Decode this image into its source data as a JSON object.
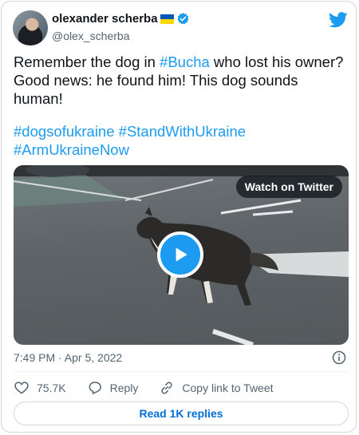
{
  "author": {
    "name": "olexander scherba",
    "handle": "@olex_scherba",
    "verified": true
  },
  "tweet": {
    "text_lines": [
      "Remember the dog in ",
      " who lost his owner? Good news: he found him! This dog sounds human!"
    ],
    "hashtag_inline": "#Bucha",
    "hashtags": [
      "#dogsofukraine",
      "#StandWithUkraine",
      "#ArmUkraineNow"
    ]
  },
  "media": {
    "watch_label": "Watch on Twitter"
  },
  "meta": {
    "timestamp": "7:49 PM · Apr 5, 2022"
  },
  "actions": {
    "likes": "75.7K",
    "reply_label": "Reply",
    "copy_label": "Copy link to Tweet"
  },
  "replies_button": "Read 1K replies",
  "colors": {
    "accent": "#1d9bf0",
    "text": "#0f1419",
    "muted": "#536471",
    "border": "#cfd9de"
  },
  "icons": [
    "twitter-bird-icon",
    "verified-badge-icon",
    "play-icon",
    "info-icon",
    "heart-icon",
    "reply-icon",
    "link-icon"
  ]
}
